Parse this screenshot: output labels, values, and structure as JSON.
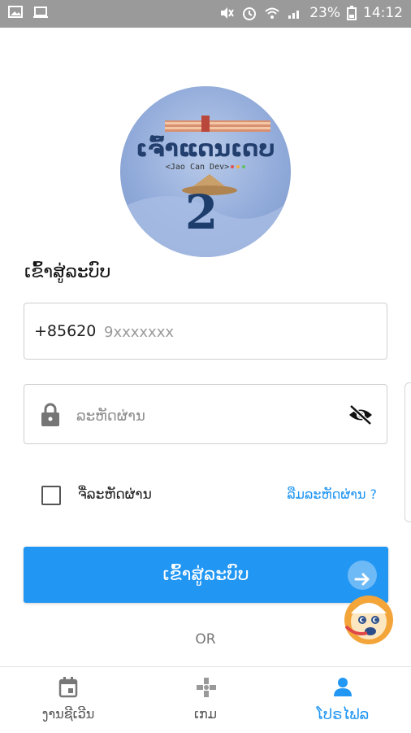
{
  "status_bar": {
    "battery": "23%",
    "time": "14:12"
  },
  "logo": {
    "title": "ເຈົ້າແດນເດບ",
    "subtitle": "<Jao Can Dev>",
    "number": "2"
  },
  "login_title": "ເຂົ້າສູ່ລະບົບ",
  "phone": {
    "prefix": "+85620",
    "placeholder": "9xxxxxxx",
    "value": ""
  },
  "password": {
    "placeholder": "ລະຫັດຜ່ານ",
    "value": ""
  },
  "remember": {
    "label": "ຈື່ລະຫັດຜ່ານ",
    "checked": false
  },
  "forgot_link": "ລືມລະຫັດຜ່ານ ?",
  "login_button": "ເຂົ້າສູ່ລະບົບ",
  "or_text": "OR",
  "nav": [
    {
      "label": "ງານຊີເວີນ",
      "icon": "calendar-icon",
      "active": false
    },
    {
      "label": "ເກມ",
      "icon": "gamepad-icon",
      "active": false
    },
    {
      "label": "ໂປຣໄຟລ",
      "icon": "person-icon",
      "active": true
    }
  ],
  "colors": {
    "accent": "#2196f3",
    "status_bar": "#9a9a9a"
  }
}
